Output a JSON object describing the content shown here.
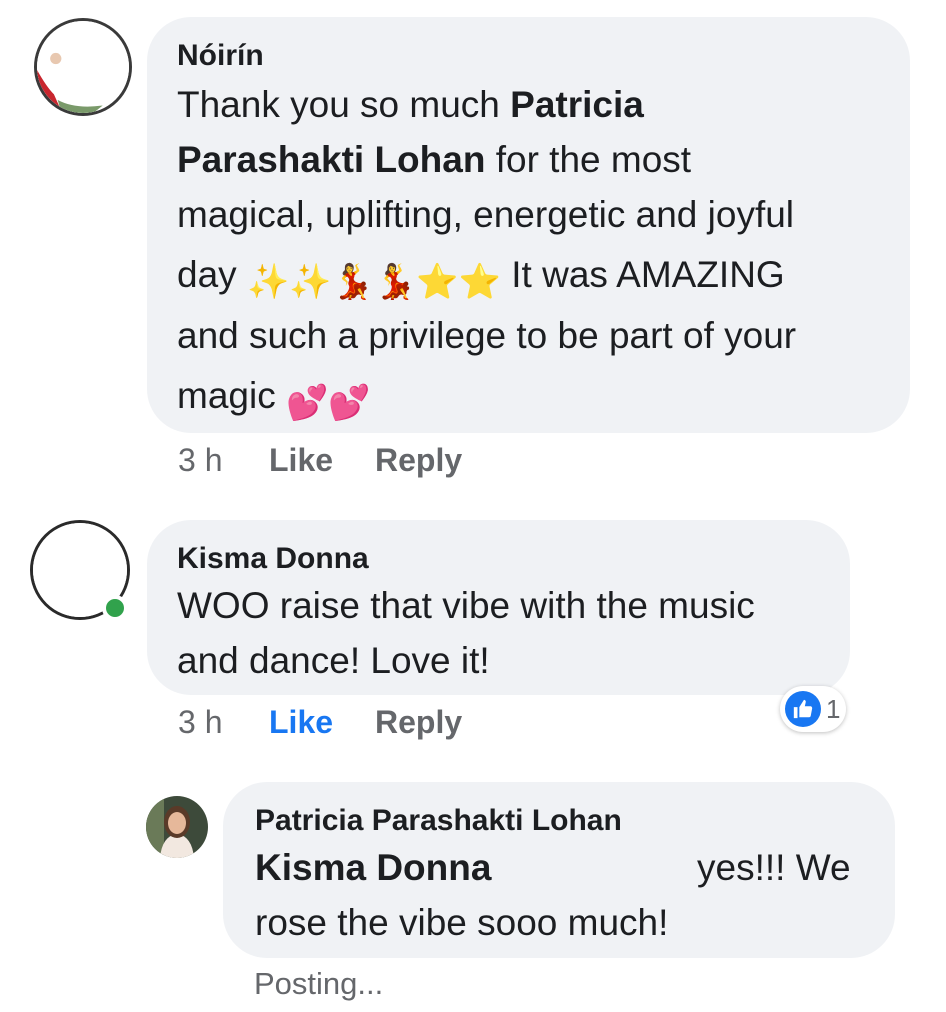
{
  "comments": [
    {
      "author": "Nóirín",
      "body": {
        "l1_a": "Thank you so much ",
        "l1_b": "Patricia",
        "l2_a": "Parashakti Lohan",
        "l2_b": " for the most",
        "l3": "magical, uplifting, energetic and joyful",
        "l4_a": "day",
        "l4_b": "It was AMAZING",
        "l5": "and such a privilege to be part of your",
        "l6": "magic"
      },
      "time": "3 h",
      "like_label": "Like",
      "reply_label": "Reply"
    },
    {
      "author": "Kisma Donna",
      "body": {
        "l1": "WOO raise that vibe with the music",
        "l2": "and dance! Love it!"
      },
      "time": "3 h",
      "like_label": "Like",
      "reply_label": "Reply",
      "reaction_count": "1"
    }
  ],
  "reply": {
    "author": "Patricia Parashakti Lohan",
    "mention": "Kisma Donna",
    "text_l1": "yes!!! We",
    "text_l2": "rose the vibe sooo much!",
    "status": "Posting..."
  },
  "icons": {
    "sparkles": "sparkles-icon",
    "dancer": "dancer-icon",
    "star": "star-icon",
    "heart": "two-hearts-icon",
    "like": "thumbs-up-icon"
  },
  "colors": {
    "bubble": "#f0f2f5",
    "link_blue": "#1877f2",
    "online": "#31a24c",
    "meta_gray": "#65676b"
  }
}
